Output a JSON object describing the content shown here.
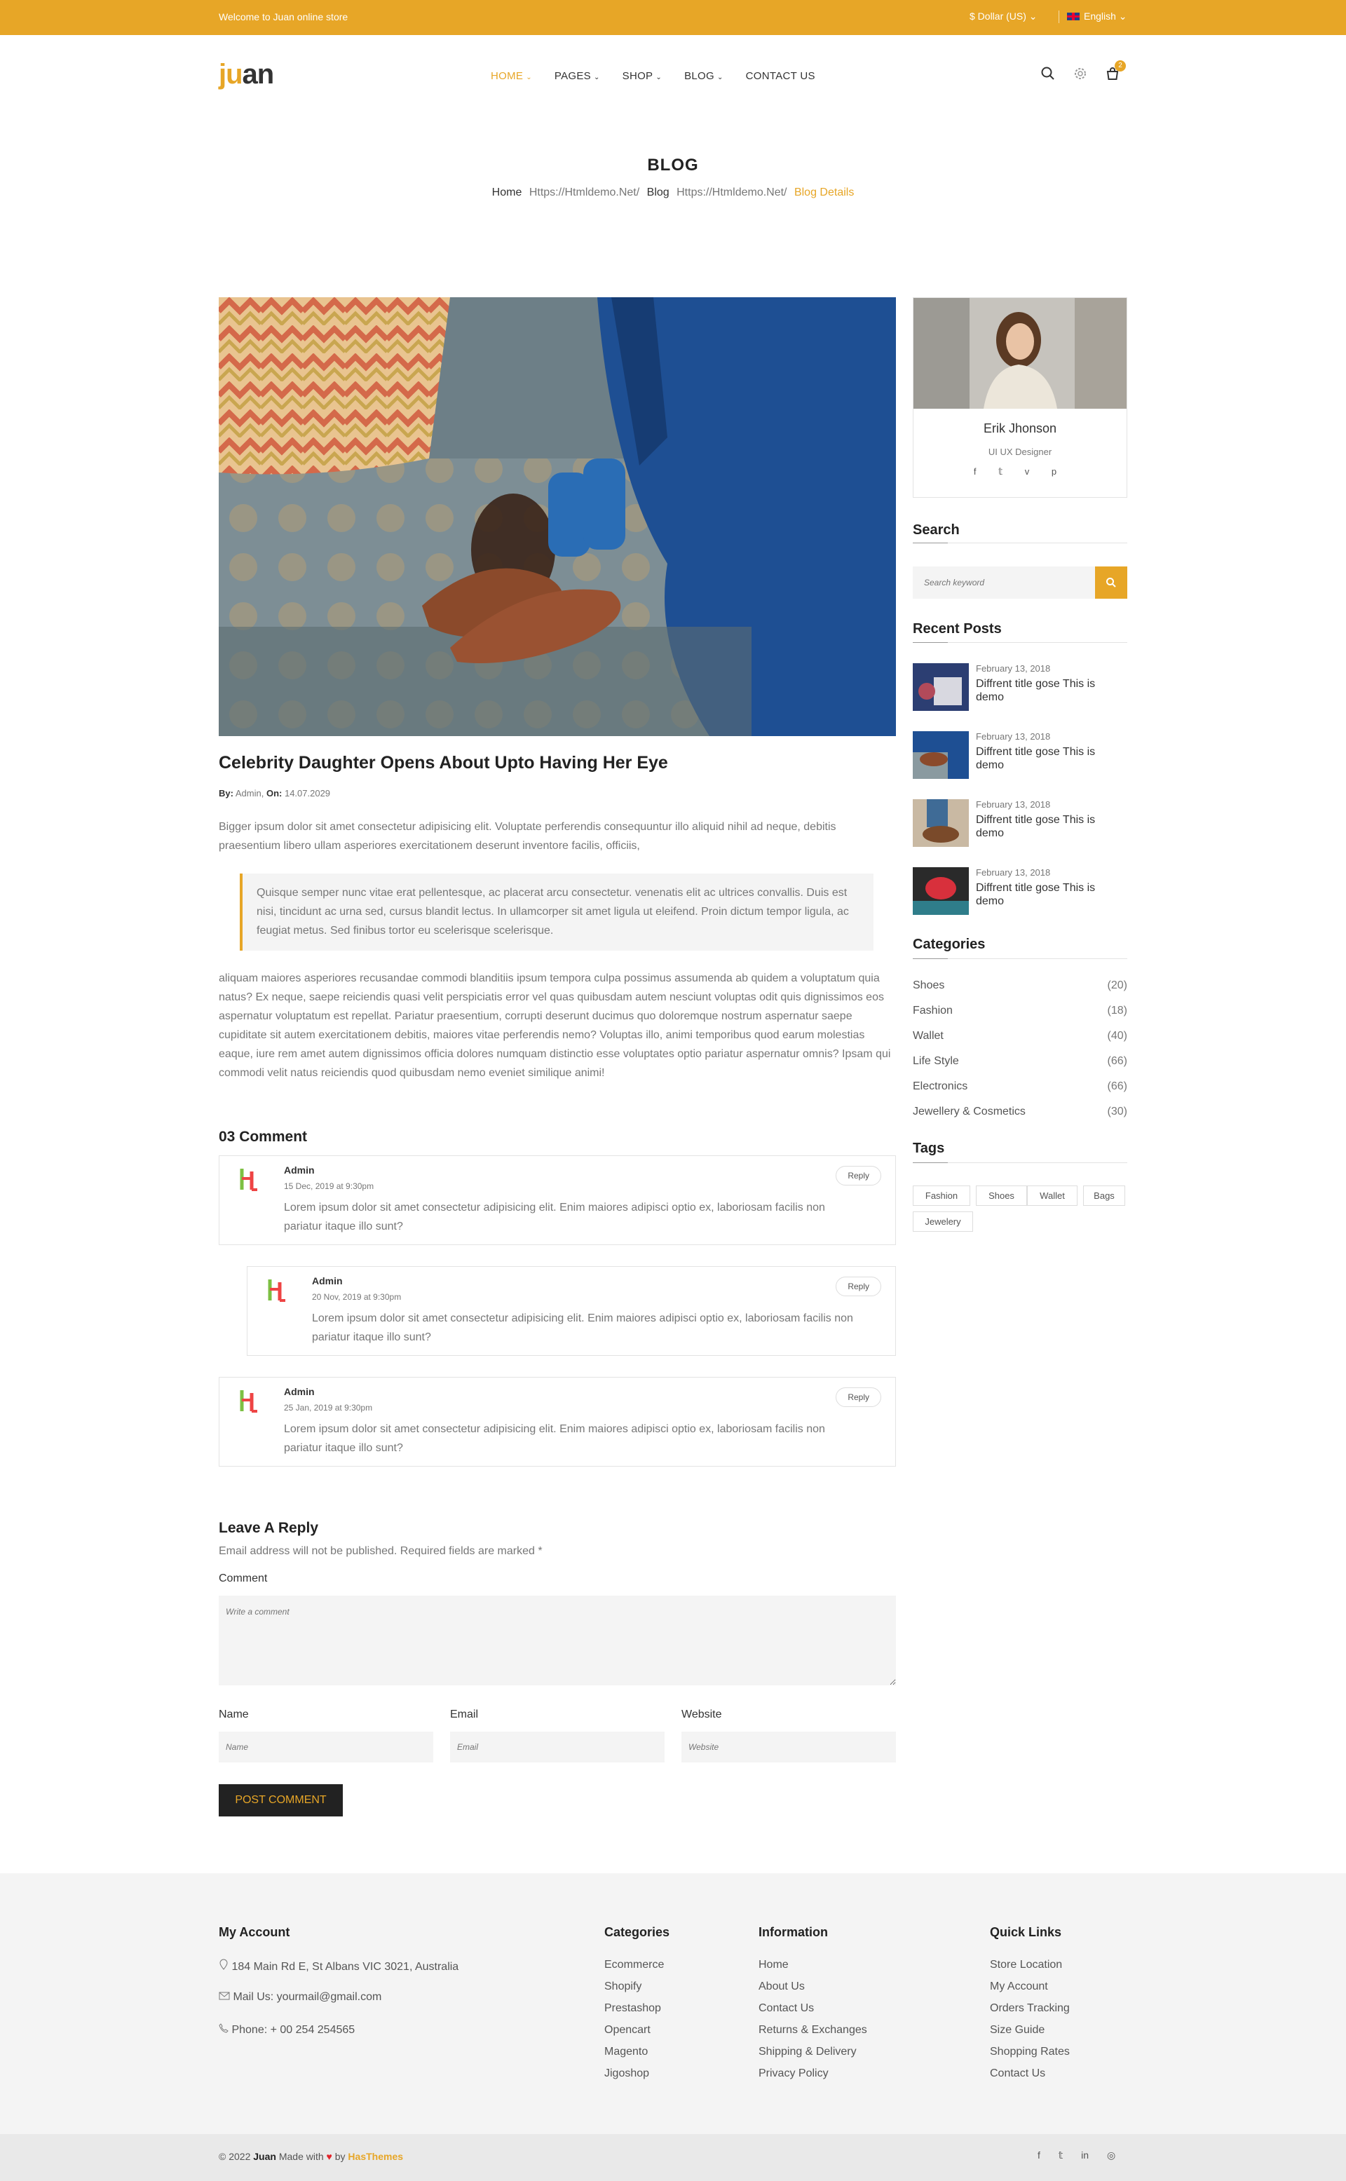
{
  "topbar": {
    "welcome": "Welcome to Juan online store",
    "currency": "$ Dollar (US) ⌄",
    "language": "English ⌄"
  },
  "header": {
    "logo_ju": "ju",
    "logo_an": "an",
    "nav": [
      {
        "label": "HOME",
        "caret": "⌄"
      },
      {
        "label": "PAGES",
        "caret": "⌄"
      },
      {
        "label": "SHOP",
        "caret": "⌄"
      },
      {
        "label": "BLOG",
        "caret": "⌄"
      },
      {
        "label": "CONTACT US",
        "caret": ""
      }
    ],
    "cart_count": "2"
  },
  "breadcrumb": {
    "title": "BLOG",
    "home": "Home",
    "url1": "Https://Htmldemo.Net/",
    "blog": "Blog",
    "url2": "Https://Htmldemo.Net/",
    "current": "Blog Details"
  },
  "post": {
    "title": "Celebrity Daughter Opens About Upto Having Her Eye",
    "by_label": "By:",
    "author": "Admin,",
    "on_label": "On:",
    "date": "14.07.2029",
    "p1": "Bigger ipsum dolor sit amet consectetur adipisicing elit. Voluptate perferendis consequuntur illo aliquid nihil ad neque, debitis praesentium libero ullam asperiores exercitationem deserunt inventore facilis, officiis,",
    "quote": "Quisque semper nunc vitae erat pellentesque, ac placerat arcu consectetur. venenatis elit ac ultrices convallis. Duis est nisi, tincidunt ac urna sed, cursus blandit lectus. In ullamcorper sit amet ligula ut eleifend. Proin dictum tempor ligula, ac feugiat metus. Sed finibus tortor eu scelerisque scelerisque.",
    "p2": "aliquam maiores asperiores recusandae commodi blanditiis ipsum tempora culpa possimus assumenda ab quidem a voluptatum quia natus? Ex neque, saepe reiciendis quasi velit perspiciatis error vel quas quibusdam autem nesciunt voluptas odit quis dignissimos eos aspernatur voluptatum est repellat. Pariatur praesentium, corrupti deserunt ducimus quo doloremque nostrum aspernatur saepe cupiditate sit autem exercitationem debitis, maiores vitae perferendis nemo? Voluptas illo, animi temporibus quod earum molestias eaque, iure rem amet autem dignissimos officia dolores numquam distinctio esse voluptates optio pariatur aspernatur omnis? Ipsam qui commodi velit natus reiciendis quod quibusdam nemo eveniet similique animi!"
  },
  "comments": {
    "title": "03 Comment",
    "items": [
      {
        "name": "Admin",
        "date": "15 Dec, 2019 at 9:30pm",
        "text": "Lorem ipsum dolor sit amet consectetur adipisicing elit. Enim maiores adipisci optio ex, laboriosam facilis non pariatur itaque illo sunt?",
        "reply": "Reply"
      },
      {
        "name": "Admin",
        "date": "20 Nov, 2019 at 9:30pm",
        "text": "Lorem ipsum dolor sit amet consectetur adipisicing elit. Enim maiores adipisci optio ex, laboriosam facilis non pariatur itaque illo sunt?",
        "reply": "Reply"
      },
      {
        "name": "Admin",
        "date": "25 Jan, 2019 at 9:30pm",
        "text": "Lorem ipsum dolor sit amet consectetur adipisicing elit. Enim maiores adipisci optio ex, laboriosam facilis non pariatur itaque illo sunt?",
        "reply": "Reply"
      }
    ]
  },
  "reply_form": {
    "title": "Leave A Reply",
    "note": "Email address will not be published. Required fields are marked *",
    "comment_label": "Comment",
    "comment_placeholder": "Write a comment",
    "name_label": "Name",
    "name_placeholder": "Name",
    "email_label": "Email",
    "email_placeholder": "Email",
    "website_label": "Website",
    "website_placeholder": "Website",
    "submit": "POST COMMENT"
  },
  "sidebar": {
    "author": {
      "name": "Erik Jhonson",
      "role": "UI UX Designer",
      "social": "f 𝕥 v p"
    },
    "search": {
      "title": "Search",
      "placeholder": "Search keyword"
    },
    "recent": {
      "title": "Recent Posts",
      "items": [
        {
          "date": "February 13, 2018",
          "title": "Diffrent title gose This is demo"
        },
        {
          "date": "February 13, 2018",
          "title": "Diffrent title gose This is demo"
        },
        {
          "date": "February 13, 2018",
          "title": "Diffrent title gose This is demo"
        },
        {
          "date": "February 13, 2018",
          "title": "Diffrent title gose This is demo"
        }
      ]
    },
    "categories": {
      "title": "Categories",
      "items": [
        {
          "name": "Shoes",
          "count": "(20)"
        },
        {
          "name": "Fashion",
          "count": "(18)"
        },
        {
          "name": "Wallet",
          "count": "(40)"
        },
        {
          "name": "Life Style",
          "count": "(66)"
        },
        {
          "name": "Electronics",
          "count": "(66)"
        },
        {
          "name": "Jewellery & Cosmetics",
          "count": "(30)"
        }
      ]
    },
    "tags": {
      "title": "Tags",
      "items": [
        "Fashion",
        "Shoes",
        "Wallet",
        "Bags",
        "Jewelery"
      ]
    }
  },
  "footer": {
    "account": {
      "title": "My Account",
      "address": "184 Main Rd E, St Albans VIC 3021, Australia",
      "mail": "Mail Us: yourmail@gmail.com",
      "phone": "Phone: + 00 254 254565"
    },
    "categories": {
      "title": "Categories",
      "items": [
        "Ecommerce",
        "Shopify",
        "Prestashop",
        "Opencart",
        "Magento",
        "Jigoshop"
      ]
    },
    "information": {
      "title": "Information",
      "items": [
        "Home",
        "About Us",
        "Contact Us",
        "Returns & Exchanges",
        "Shipping & Delivery",
        "Privacy Policy"
      ]
    },
    "quick": {
      "title": "Quick Links",
      "items": [
        "Store Location",
        "My Account",
        "Orders Tracking",
        "Size Guide",
        "Shopping Rates",
        "Contact Us"
      ]
    },
    "copyright_pre": "© 2022",
    "brand": "Juan",
    "made": "Made with",
    "by": "by",
    "company": "HasThemes",
    "social": "f 𝕥 in ◎"
  },
  "colors": {
    "accent": "#e7a627",
    "dark": "#222222",
    "footer_bg": "#f4f4f4"
  }
}
